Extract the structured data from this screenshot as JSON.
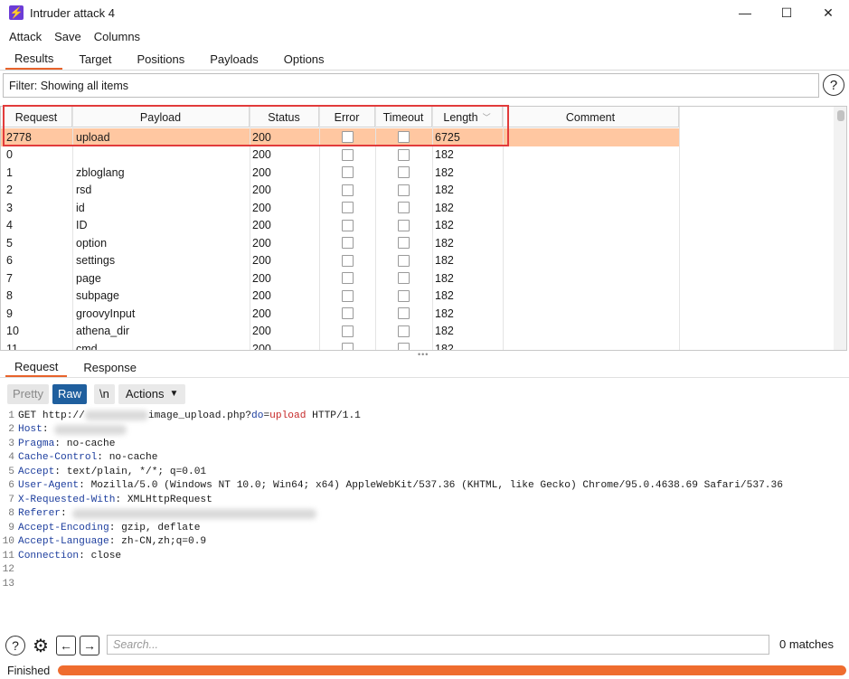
{
  "window": {
    "title": "Intruder attack 4",
    "app_icon": "burp-lightning-icon",
    "controls": [
      "minimize",
      "maximize",
      "close"
    ]
  },
  "menu": [
    "Attack",
    "Save",
    "Columns"
  ],
  "tabs": [
    {
      "label": "Results",
      "active": true
    },
    {
      "label": "Target",
      "active": false
    },
    {
      "label": "Positions",
      "active": false
    },
    {
      "label": "Payloads",
      "active": false
    },
    {
      "label": "Options",
      "active": false
    }
  ],
  "filter": {
    "text": "Filter: Showing all items",
    "help": "?"
  },
  "results_table": {
    "columns": [
      "Request",
      "Payload",
      "Status",
      "Error",
      "Timeout",
      "Length",
      "Comment"
    ],
    "rows": [
      {
        "request": "2778",
        "payload": "upload",
        "status": "200",
        "length": "6725",
        "selected": true
      },
      {
        "request": "0",
        "payload": "",
        "status": "200",
        "length": "182"
      },
      {
        "request": "1",
        "payload": "zbloglang",
        "status": "200",
        "length": "182"
      },
      {
        "request": "2",
        "payload": "rsd",
        "status": "200",
        "length": "182"
      },
      {
        "request": "3",
        "payload": "id",
        "status": "200",
        "length": "182"
      },
      {
        "request": "4",
        "payload": "ID",
        "status": "200",
        "length": "182"
      },
      {
        "request": "5",
        "payload": "option",
        "status": "200",
        "length": "182"
      },
      {
        "request": "6",
        "payload": "settings",
        "status": "200",
        "length": "182"
      },
      {
        "request": "7",
        "payload": "page",
        "status": "200",
        "length": "182"
      },
      {
        "request": "8",
        "payload": "subpage",
        "status": "200",
        "length": "182"
      },
      {
        "request": "9",
        "payload": "groovyInput",
        "status": "200",
        "length": "182"
      },
      {
        "request": "10",
        "payload": "athena_dir",
        "status": "200",
        "length": "182"
      },
      {
        "request": "11",
        "payload": "cmd",
        "status": "200",
        "length": "182"
      }
    ]
  },
  "detail_tabs": [
    {
      "label": "Request",
      "active": true
    },
    {
      "label": "Response",
      "active": false
    }
  ],
  "editor_toolbar": {
    "pretty": "Pretty",
    "raw": "Raw",
    "newline": "\\n",
    "actions": "Actions"
  },
  "request_lines": {
    "l1": {
      "n": "1",
      "a": "GET http://",
      "b": "image_upload.php?",
      "c": "do",
      "d": "=",
      "e": "upload",
      "f": " HTTP/1.1"
    },
    "l2": {
      "n": "2",
      "h": "Host",
      "v": ": "
    },
    "l3": {
      "n": "3",
      "h": "Pragma",
      "v": ": no-cache"
    },
    "l4": {
      "n": "4",
      "h": "Cache-Control",
      "v": ": no-cache"
    },
    "l5": {
      "n": "5",
      "h": "Accept",
      "v": ": text/plain, */*; q=0.01"
    },
    "l6": {
      "n": "6",
      "h": "User-Agent",
      "v": ": Mozilla/5.0 (Windows NT 10.0; Win64; x64) AppleWebKit/537.36 (KHTML, like Gecko) Chrome/95.0.4638.69 Safari/537.36"
    },
    "l7": {
      "n": "7",
      "h": "X-Requested-With",
      "v": ": XMLHttpRequest"
    },
    "l8": {
      "n": "8",
      "h": "Referer",
      "v": ": "
    },
    "l9": {
      "n": "9",
      "h": "Accept-Encoding",
      "v": ": gzip, deflate"
    },
    "l10": {
      "n": "10",
      "h": "Accept-Language",
      "v": ": zh-CN,zh;q=0.9"
    },
    "l11": {
      "n": "11",
      "h": "Connection",
      "v": ": close"
    },
    "l12": {
      "n": "12"
    },
    "l13": {
      "n": "13"
    }
  },
  "search": {
    "placeholder": "Search...",
    "matches": "0 matches"
  },
  "status": {
    "text": "Finished",
    "progress_percent": 100
  },
  "colors": {
    "accent": "#ef6c2e",
    "selected_row": "#ffc7a1",
    "raw_button": "#1f5f9e",
    "highlight": "#e23b3b"
  }
}
